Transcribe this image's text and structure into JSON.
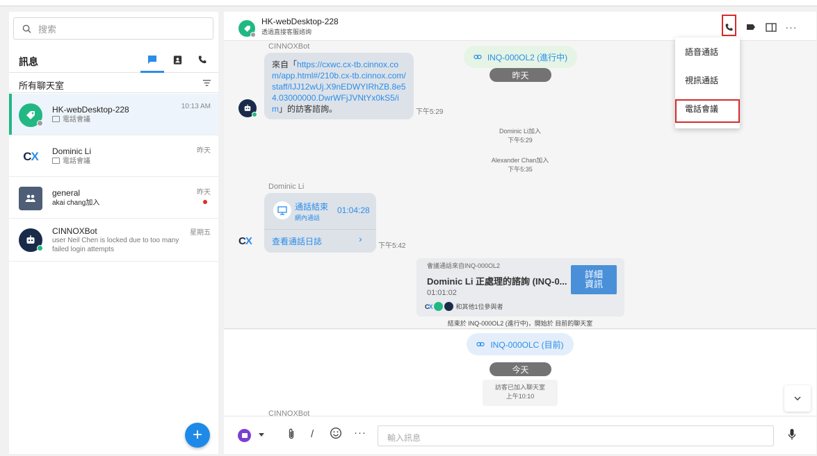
{
  "colors": {
    "accent": "#2b8de8",
    "green": "#21b884",
    "highlight": "#d62b2b",
    "bubble": "#dde2e9"
  },
  "sidebar": {
    "search_placeholder": "搜索",
    "header_title": "訊息",
    "filter_label": "所有聊天室",
    "chats": [
      {
        "name": "HK-webDesktop-228",
        "sub": "電話會議",
        "time": "10:13 AM",
        "icon": "tag-icon"
      },
      {
        "name": "Dominic Li",
        "sub": "電話會議",
        "time": "昨天",
        "icon": "cx-logo-icon"
      },
      {
        "name": "general",
        "sub": "akai chang加入",
        "time": "昨天",
        "icon": "group-icon"
      },
      {
        "name": "CINNOXBot",
        "sub": "user Neil Chen is locked due to too many failed login attempts",
        "time": "星期五",
        "icon": "bot-icon"
      }
    ],
    "fab_label": "+"
  },
  "header": {
    "title": "HK-webDesktop-228",
    "subtitle": "透過直接客服諮詢"
  },
  "call_menu": {
    "items": [
      "語音通話",
      "視訊通話",
      "電話會議"
    ]
  },
  "messages": {
    "bot_sender": "CINNOXBot",
    "bot_text_prefix": "來自「",
    "bot_link": "https://cxwc.cx-tb.cinnox.com/app.html#/210b.cx-tb.cinnox.com/staff/IJJ12wUj.X9nEDWYIRhZB.8e54.03000000.DwrWFjJVNtYx0kS5/im",
    "bot_text_suffix": "」的訪客諮詢。",
    "bot_time": "下午5:29",
    "inquiry_top": "INQ-000OL2 (進行中)",
    "yesterday": "昨天",
    "sys1_text": "Dominic Li加入",
    "sys1_time": "下午5:29",
    "sys2_text": "Alexander Chan加入",
    "sys2_time": "下午5:35",
    "call_sender": "Dominic Li",
    "call_title": "通話結束",
    "call_sub": "網內通話",
    "call_duration": "01:04:28",
    "call_log_link": "查看通話日誌",
    "call_time": "下午5:42",
    "conf_from": "會議通話來自INQ-000OL2",
    "conf_title": "Dominic Li 正處理的諮詢 (INQ-0...",
    "conf_duration": "01:01:02",
    "conf_participants": "和其他1位參與者",
    "conf_button": "詳細資訊",
    "ended_banner": "結束於 INQ-000OL2 (進行中)，開始於 目前的聊天室",
    "inquiry_current": "INQ-000OLC (目前)",
    "today": "今天",
    "visitor_joined": "訪客已加入聊天室",
    "visitor_time": "上午10:10",
    "bottom_sender": "CINNOXBot"
  },
  "composer": {
    "placeholder": "輸入訊息"
  }
}
